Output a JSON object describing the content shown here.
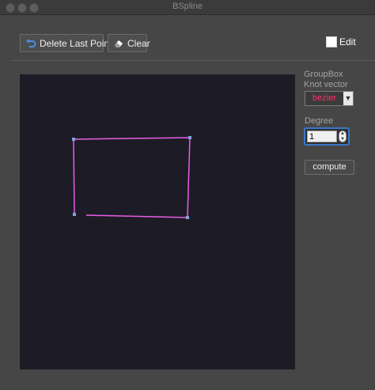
{
  "window": {
    "title": "BSpline"
  },
  "toolbar": {
    "delete_label": "Delete Last Point",
    "clear_label": "Clear",
    "edit_label": "Edit"
  },
  "panel": {
    "groupbox_label": "GroupBox",
    "knot_vector_label": "Knot vector",
    "knot_vector_value": "bezier",
    "degree_label": "Degree",
    "degree_value": "1",
    "compute_label": "compute"
  },
  "curve": {
    "color": "#e85ee6",
    "point_color": "#7fa3d8",
    "background": "#1d1c26"
  }
}
